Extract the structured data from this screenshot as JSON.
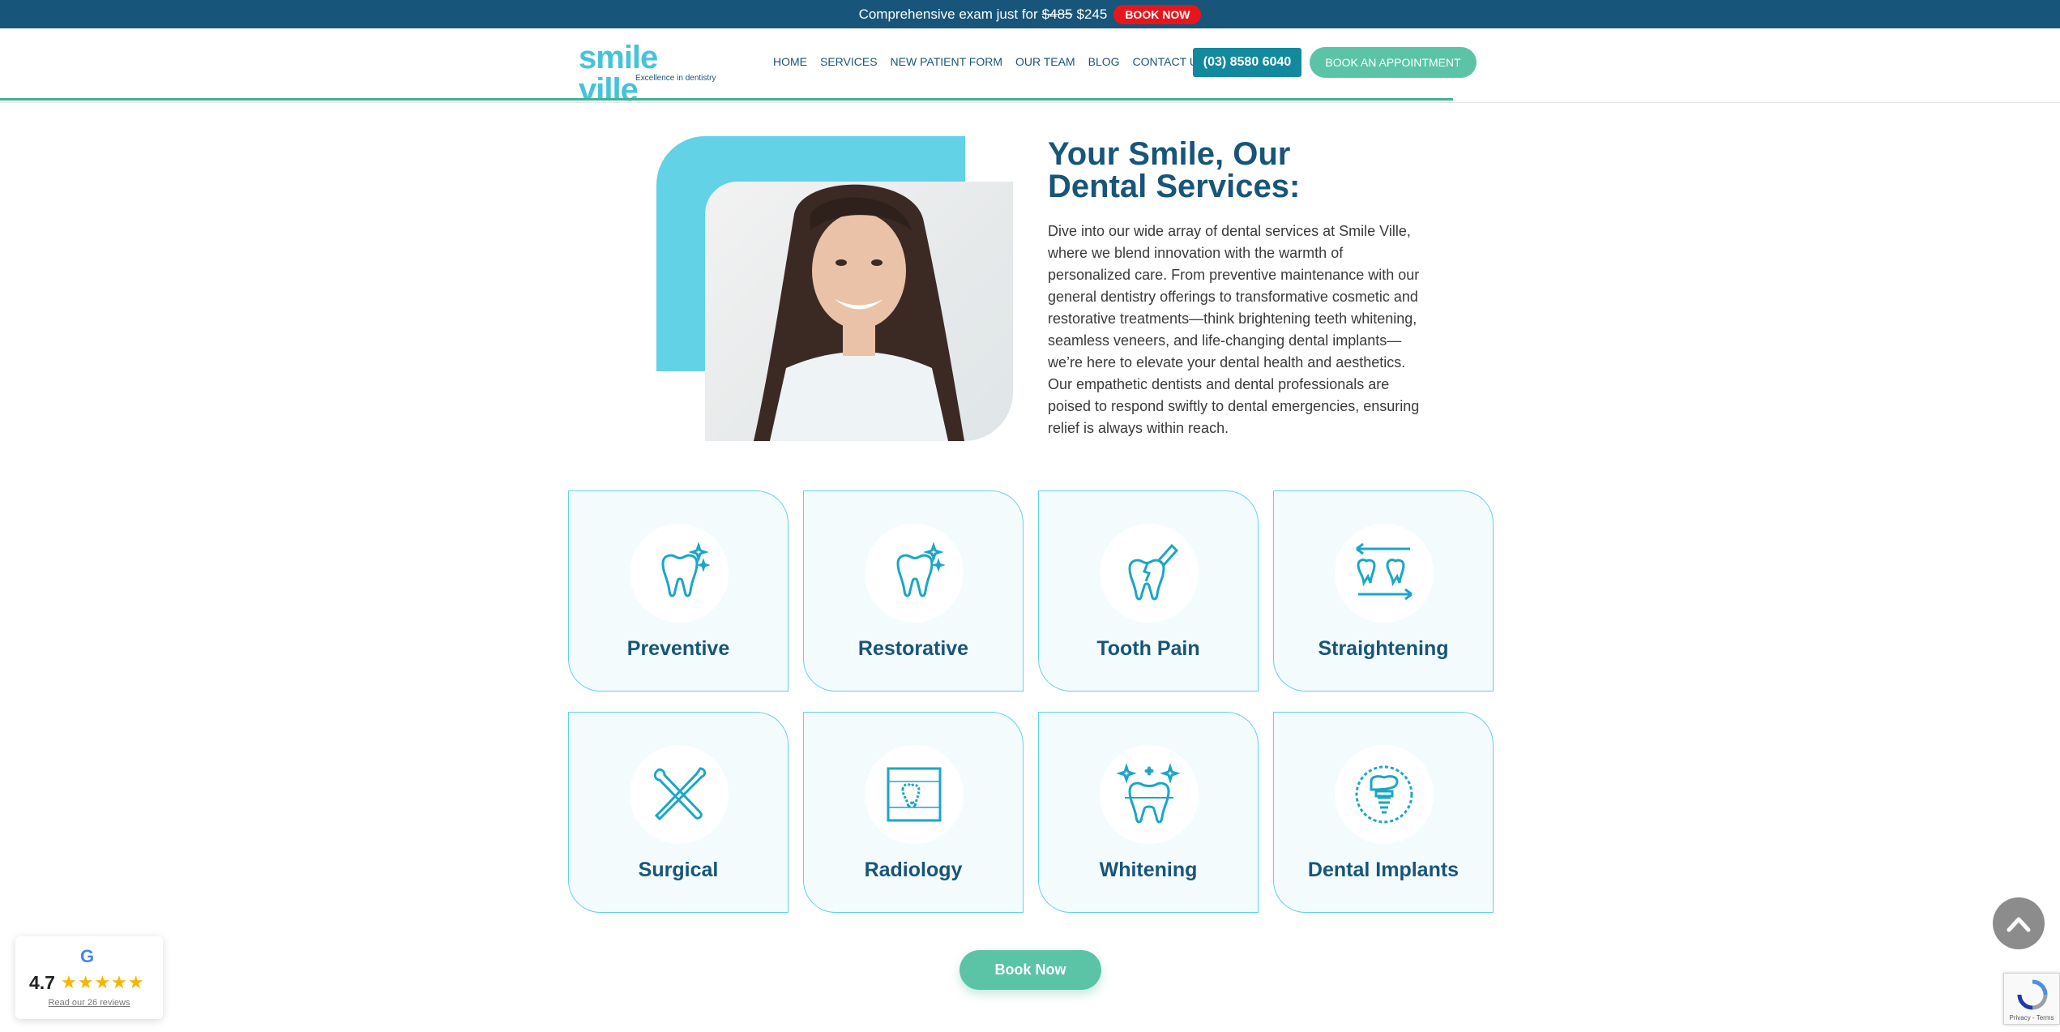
{
  "promo": {
    "text": "Comprehensive exam just for",
    "old_price": "$485",
    "new_price": "$245",
    "button": "BOOK NOW"
  },
  "logo": {
    "word": "smile ville",
    "tagline": "Excellence in dentistry"
  },
  "nav": {
    "items": [
      "HOME",
      "SERVICES",
      "NEW PATIENT FORM",
      "OUR TEAM",
      "BLOG",
      "CONTACT US"
    ],
    "phone": "(03) 8580 6040",
    "appointment": "BOOK AN APPOINTMENT"
  },
  "hero": {
    "title_line1": "Your Smile, Our",
    "title_line2": "Dental Services:",
    "body": "Dive into our wide array of dental services at Smile Ville, where we blend innovation with the warmth of personalized care. From preventive maintenance with our general dentistry offerings to transformative cosmetic and restorative treatments—think brightening teeth whitening, seamless veneers, and life-changing dental implants—we’re here to elevate your dental health and aesthetics. Our empathetic dentists and dental professionals are poised to respond swiftly to dental emergencies, ensuring relief is always within reach."
  },
  "services": [
    {
      "label": "Preventive",
      "icon": "tooth-sparkle-icon"
    },
    {
      "label": "Restorative",
      "icon": "tooth-sparkle-icon"
    },
    {
      "label": "Tooth Pain",
      "icon": "tooth-pain-icon"
    },
    {
      "label": "Straightening",
      "icon": "teeth-arrows-icon"
    },
    {
      "label": "Surgical",
      "icon": "dental-tools-icon"
    },
    {
      "label": "Radiology",
      "icon": "tooth-xray-icon"
    },
    {
      "label": "Whitening",
      "icon": "tooth-whitening-icon"
    },
    {
      "label": "Dental Implants",
      "icon": "dental-implant-icon"
    }
  ],
  "book_now": "Book Now",
  "reviews": {
    "score": "4.7",
    "stars": "★★★★★",
    "link": "Read our 26 reviews",
    "google": "G"
  },
  "recaptcha": {
    "text": "Privacy - Terms"
  },
  "colors": {
    "navy": "#17557a",
    "teal": "#62d2e6",
    "green": "#5bc4a6",
    "promo_red": "#e8161c"
  }
}
